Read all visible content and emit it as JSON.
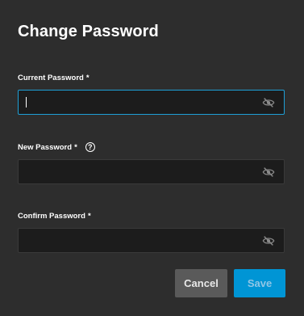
{
  "dialog": {
    "title": "Change Password"
  },
  "fields": {
    "current": {
      "label": "Current Password",
      "required_mark": "*",
      "value": ""
    },
    "new": {
      "label": "New Password",
      "required_mark": "*",
      "help_icon_glyph": "?",
      "value": ""
    },
    "confirm": {
      "label": "Confirm Password",
      "required_mark": "*",
      "value": ""
    }
  },
  "actions": {
    "cancel_label": "Cancel",
    "save_label": "Save"
  },
  "icons": {
    "visibility_toggle": "eye-off-icon",
    "help": "help-circle-icon"
  },
  "colors": {
    "accent": "#0095d5",
    "focus_border": "#1e9fd6",
    "dialog_bg": "#2d2d2d",
    "input_bg": "#1c1c1c"
  }
}
